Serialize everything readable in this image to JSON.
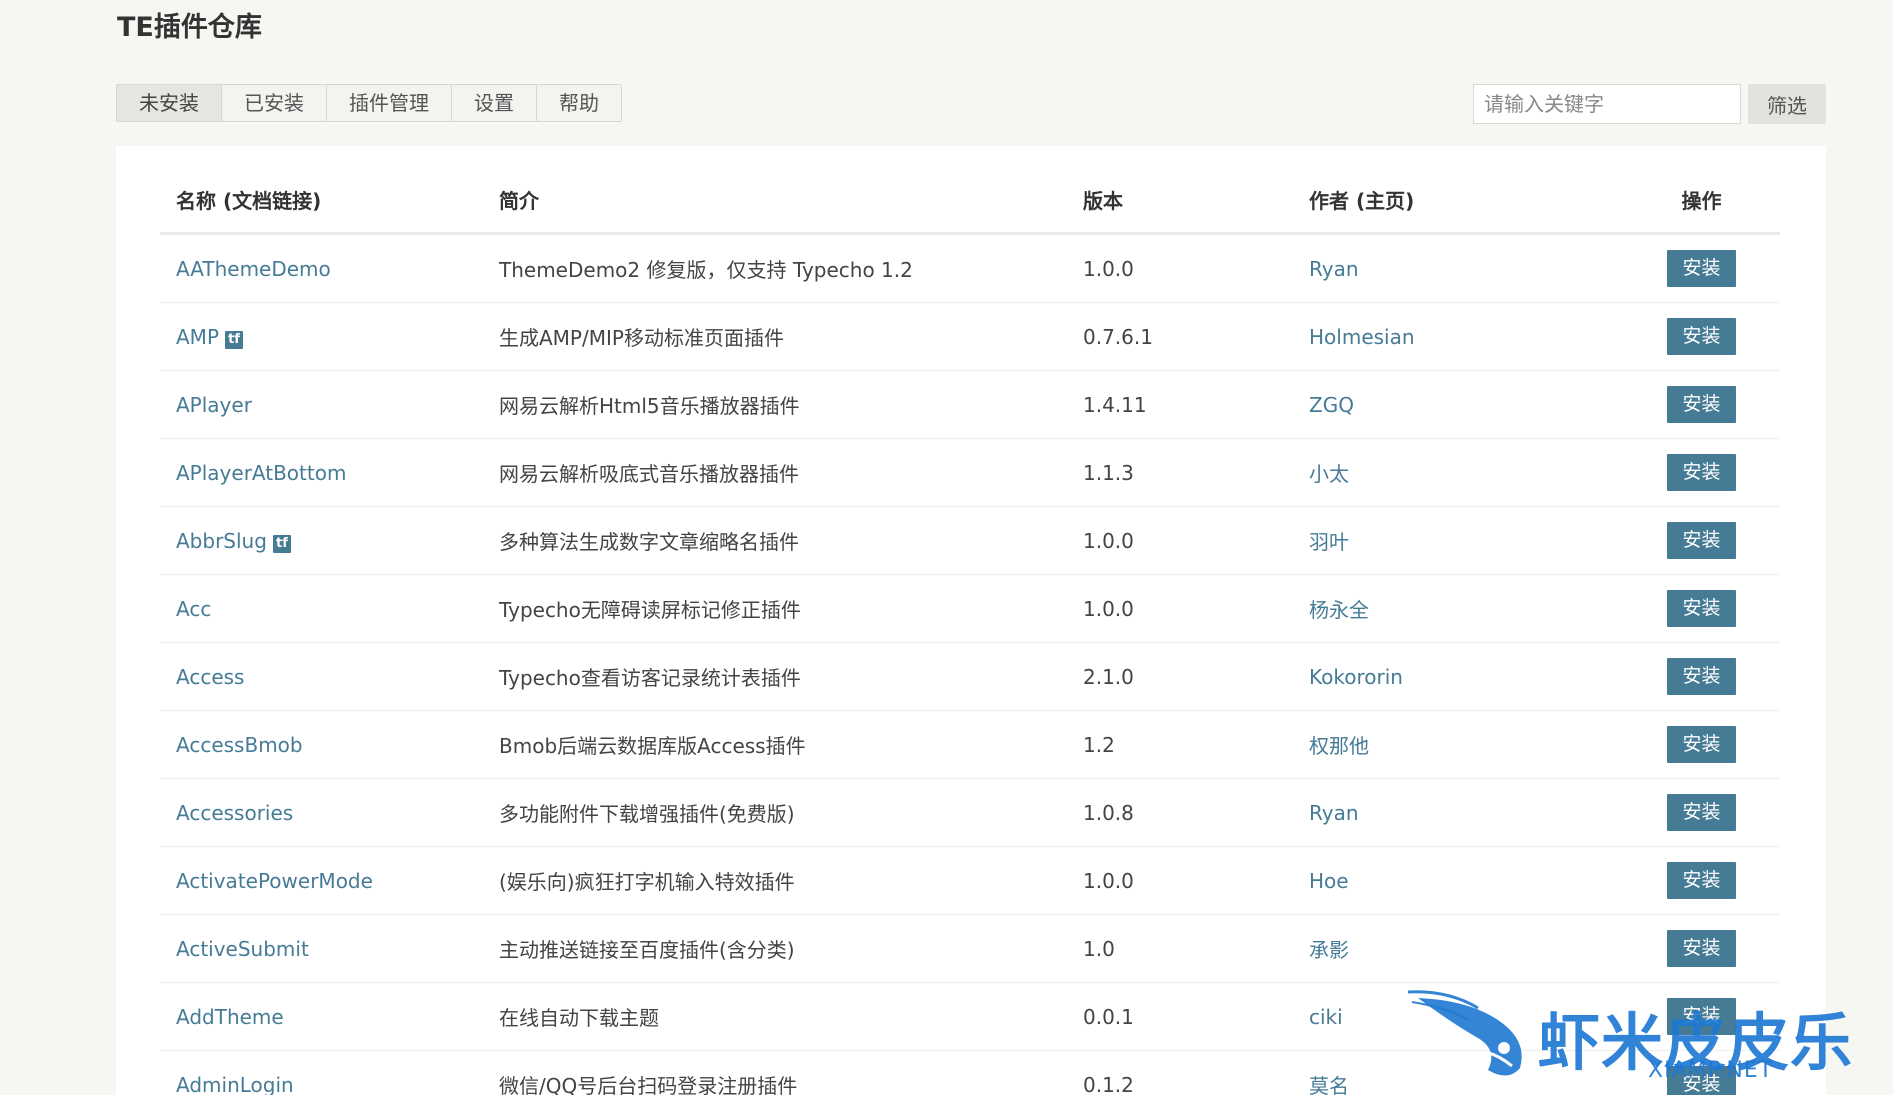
{
  "header": {
    "title": "TE插件仓库"
  },
  "tabs": [
    {
      "label": "未安装",
      "active": true
    },
    {
      "label": "已安装",
      "active": false
    },
    {
      "label": "插件管理",
      "active": false
    },
    {
      "label": "设置",
      "active": false
    },
    {
      "label": "帮助",
      "active": false
    }
  ],
  "search": {
    "placeholder": "请输入关键字",
    "value": "",
    "button_label": "筛选"
  },
  "table": {
    "columns": [
      "名称 (文档链接)",
      "简介",
      "版本",
      "作者 (主页)",
      "操作"
    ],
    "rows": [
      {
        "name": "AAThemeDemo",
        "tf": false,
        "desc": "ThemeDemo2 修复版，仅支持 Typecho 1.2",
        "version": "1.0.0",
        "author": "Ryan",
        "action": "安装"
      },
      {
        "name": "AMP",
        "tf": true,
        "desc": "生成AMP/MIP移动标准页面插件",
        "version": "0.7.6.1",
        "author": "Holmesian",
        "action": "安装"
      },
      {
        "name": "APlayer",
        "tf": false,
        "desc": "网易云解析Html5音乐播放器插件",
        "version": "1.4.11",
        "author": "ZGQ",
        "action": "安装"
      },
      {
        "name": "APlayerAtBottom",
        "tf": false,
        "desc": "网易云解析吸底式音乐播放器插件",
        "version": "1.1.3",
        "author": "小太",
        "action": "安装"
      },
      {
        "name": "AbbrSlug",
        "tf": true,
        "desc": "多种算法生成数字文章缩略名插件",
        "version": "1.0.0",
        "author": "羽叶",
        "action": "安装"
      },
      {
        "name": "Acc",
        "tf": false,
        "desc": "Typecho无障碍读屏标记修正插件",
        "version": "1.0.0",
        "author": "杨永全",
        "action": "安装"
      },
      {
        "name": "Access",
        "tf": false,
        "desc": "Typecho查看访客记录统计表插件",
        "version": "2.1.0",
        "author": "Kokororin",
        "action": "安装"
      },
      {
        "name": "AccessBmob",
        "tf": false,
        "desc": "Bmob后端云数据库版Access插件",
        "version": "1.2",
        "author": "权那他",
        "action": "安装"
      },
      {
        "name": "Accessories",
        "tf": false,
        "desc": "多功能附件下载增强插件(免费版)",
        "version": "1.0.8",
        "author": "Ryan",
        "action": "安装"
      },
      {
        "name": "ActivatePowerMode",
        "tf": false,
        "desc": "(娱乐向)疯狂打字机输入特效插件",
        "version": "1.0.0",
        "author": "Hoe",
        "action": "安装"
      },
      {
        "name": "ActiveSubmit",
        "tf": false,
        "desc": "主动推送链接至百度插件(含分类)",
        "version": "1.0",
        "author": "承影",
        "action": "安装"
      },
      {
        "name": "AddTheme",
        "tf": false,
        "desc": "在线自动下载主题",
        "version": "0.0.1",
        "author": "ciki",
        "action": "安装"
      },
      {
        "name": "AdminLogin",
        "tf": false,
        "desc": "微信/QQ号后台扫码登录注册插件",
        "version": "0.1.2",
        "author": "莫名",
        "action": "安装"
      }
    ],
    "tf_label": "tf"
  },
  "watermark": {
    "title": "虾米皮皮乐",
    "subtitle": "XIAMP.NET"
  },
  "colors": {
    "link": "#467b96",
    "button": "#467b96",
    "background": "#f6f6f3"
  }
}
